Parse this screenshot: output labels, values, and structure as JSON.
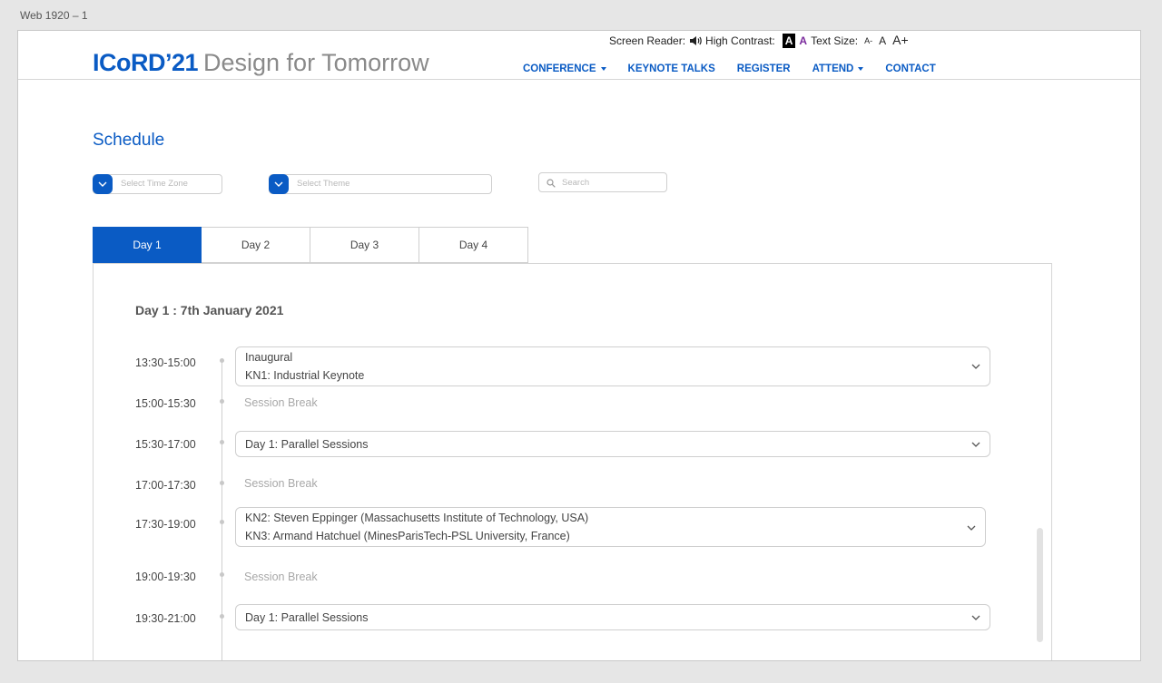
{
  "frame_label": "Web 1920 – 1",
  "header": {
    "logo": "ICoRD’21",
    "tagline": "Design for Tomorrow",
    "accessibility": {
      "screen_reader_label": "Screen Reader:",
      "high_contrast_label": "High Contrast:",
      "hc_option_black": "A",
      "hc_option_purple": "A",
      "text_size_label": "Text Size:",
      "ts_small": "A-",
      "ts_mid": "A",
      "ts_big": "A+"
    },
    "nav": [
      {
        "label": "CONFERENCE",
        "dropdown": true
      },
      {
        "label": "KEYNOTE TALKS",
        "dropdown": false
      },
      {
        "label": "REGISTER",
        "dropdown": false
      },
      {
        "label": "ATTEND",
        "dropdown": true
      },
      {
        "label": "CONTACT",
        "dropdown": false
      }
    ]
  },
  "page_title": "Schedule",
  "filters": {
    "timezone_placeholder": "Select Time Zone",
    "theme_placeholder": "Select Theme",
    "search_placeholder": "Search"
  },
  "tabs": [
    "Day 1",
    "Day 2",
    "Day 3",
    "Day 4"
  ],
  "active_tab": "Day 1",
  "day_title": "Day 1 : 7th January 2021",
  "schedule": [
    {
      "time": "13:30-15:00",
      "type": "session",
      "lines": [
        "Inaugural",
        "KN1: Industrial Keynote"
      ]
    },
    {
      "time": "15:00-15:30",
      "type": "break",
      "lines": [
        "Session Break"
      ]
    },
    {
      "time": "15:30-17:00",
      "type": "session",
      "lines": [
        "Day 1: Parallel Sessions"
      ]
    },
    {
      "time": "17:00-17:30",
      "type": "break",
      "lines": [
        "Session Break"
      ]
    },
    {
      "time": "17:30-19:00",
      "type": "session",
      "lines": [
        "KN2: Steven Eppinger (Massachusetts Institute of Technology, USA)",
        "KN3: Armand Hatchuel (MinesParisTech-PSL University, France)"
      ]
    },
    {
      "time": "19:00-19:30",
      "type": "break",
      "lines": [
        "Session Break"
      ]
    },
    {
      "time": "19:30-21:00",
      "type": "session",
      "lines": [
        "Day 1: Parallel Sessions"
      ]
    }
  ],
  "colors": {
    "accent": "#0a5bc4",
    "muted": "#8a8a8a",
    "border": "#cfcfcf"
  }
}
